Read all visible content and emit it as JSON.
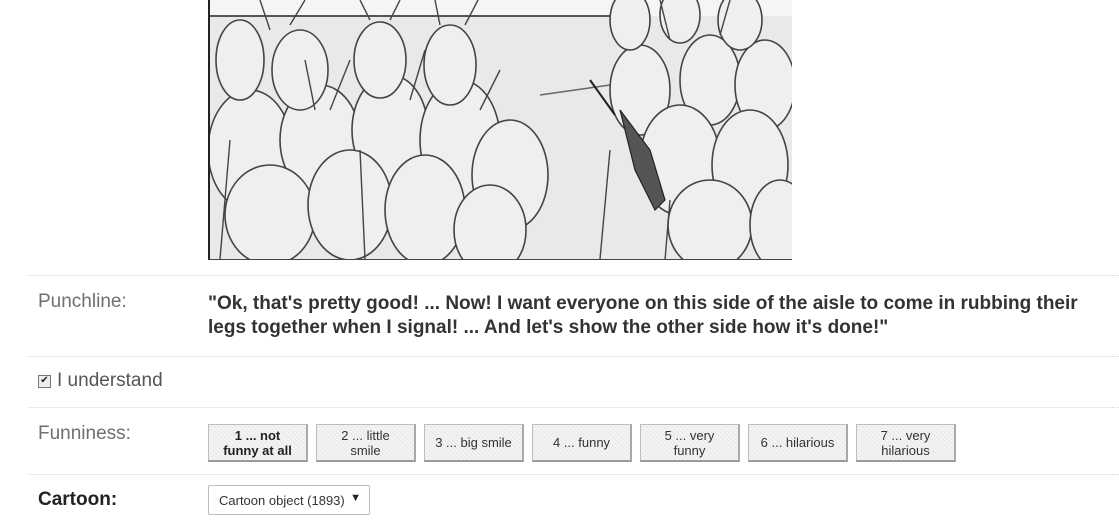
{
  "cartoon": {
    "icon": "cartoon-drawing"
  },
  "punchline": {
    "label": "Punchline:",
    "text": "\"Ok, that's pretty good! ... Now! I want everyone on this side of the aisle to come in rubbing their legs together when I signal! ... And let's show the other side how it's done!\""
  },
  "understand": {
    "label": "I understand",
    "checked": true,
    "check_glyph": "✔"
  },
  "funniness": {
    "label": "Funniness:",
    "options": [
      {
        "line1": "1 ... not",
        "line2": "funny at all"
      },
      {
        "line1": "2 ... little",
        "line2": "smile"
      },
      {
        "line1": "3 ... big smile",
        "line2": ""
      },
      {
        "line1": "4 ... funny",
        "line2": ""
      },
      {
        "line1": "5 ... very",
        "line2": "funny"
      },
      {
        "line1": "6 ... hilarious",
        "line2": ""
      },
      {
        "line1": "7 ... very",
        "line2": "hilarious"
      }
    ]
  },
  "cartoon_select": {
    "label": "Cartoon:",
    "value": "Cartoon object (1893)",
    "arrow": "▼"
  }
}
